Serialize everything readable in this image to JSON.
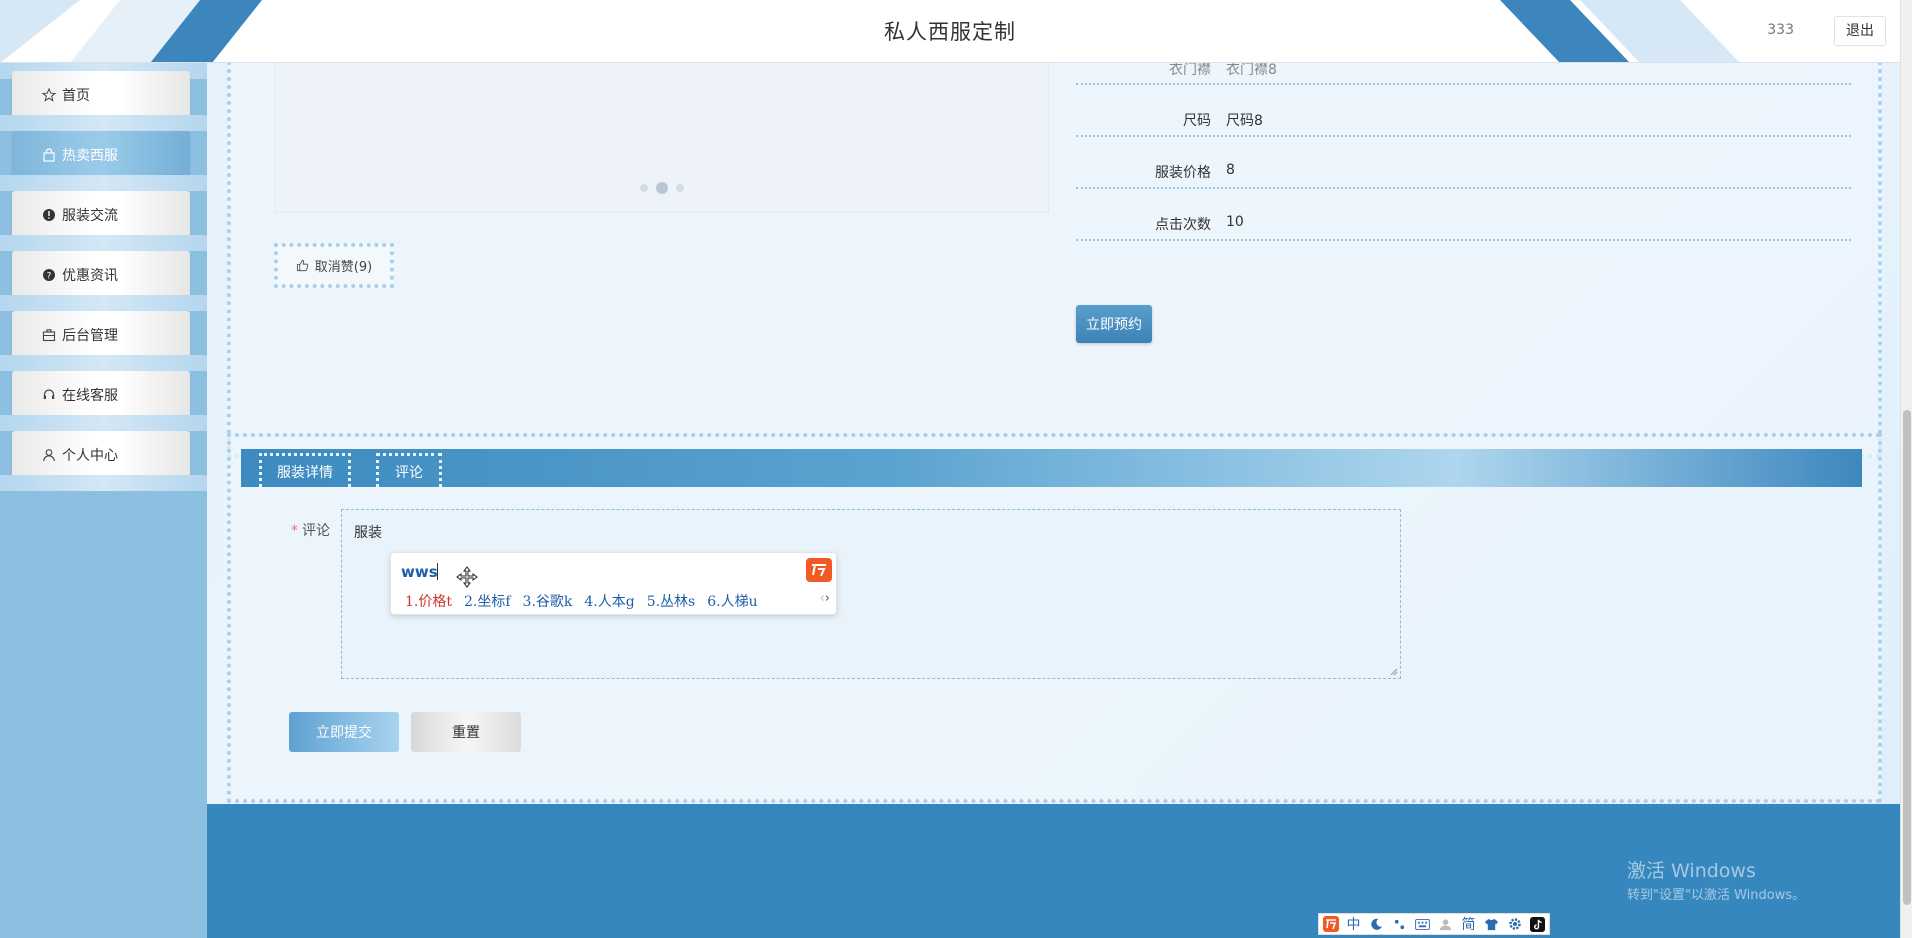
{
  "header": {
    "title": "私人西服定制",
    "user": "333",
    "logout_label": "退出"
  },
  "sidebar": {
    "items": [
      {
        "label": "首页",
        "icon": "star-icon"
      },
      {
        "label": "热卖西服",
        "icon": "bag-icon",
        "active": true
      },
      {
        "label": "服装交流",
        "icon": "alert-icon"
      },
      {
        "label": "优惠资讯",
        "icon": "question-icon"
      },
      {
        "label": "后台管理",
        "icon": "briefcase-icon"
      },
      {
        "label": "在线客服",
        "icon": "headset-icon"
      },
      {
        "label": "个人中心",
        "icon": "user-icon"
      }
    ]
  },
  "product": {
    "like_label": "取消赞(9)",
    "info": [
      {
        "label": "衣门襟",
        "value": "衣门襟8"
      },
      {
        "label": "尺码",
        "value": "尺码8"
      },
      {
        "label": "服装价格",
        "value": "8"
      },
      {
        "label": "点击次数",
        "value": "10"
      }
    ],
    "reserve_label": "立即预约"
  },
  "tabs": [
    {
      "label": "服装详情"
    },
    {
      "label": "评论"
    }
  ],
  "comment_form": {
    "label": "评论",
    "value": "服装",
    "submit_label": "立即提交",
    "reset_label": "重置"
  },
  "ime": {
    "input": "wws",
    "candidates": [
      "1.价格t",
      "2.坐标f",
      "3.谷歌k",
      "4.人本g",
      "5.丛林s",
      "6.人梯u"
    ]
  },
  "watermark": {
    "line1": "激活 Windows",
    "line2": "转到\"设置\"以激活 Windows。"
  },
  "tray": {
    "ime_mode": "中",
    "charset": "简"
  },
  "colors": {
    "accent": "#3787bf",
    "sidebar_bg": "#8dbfe0",
    "required": "#f56c6c"
  }
}
